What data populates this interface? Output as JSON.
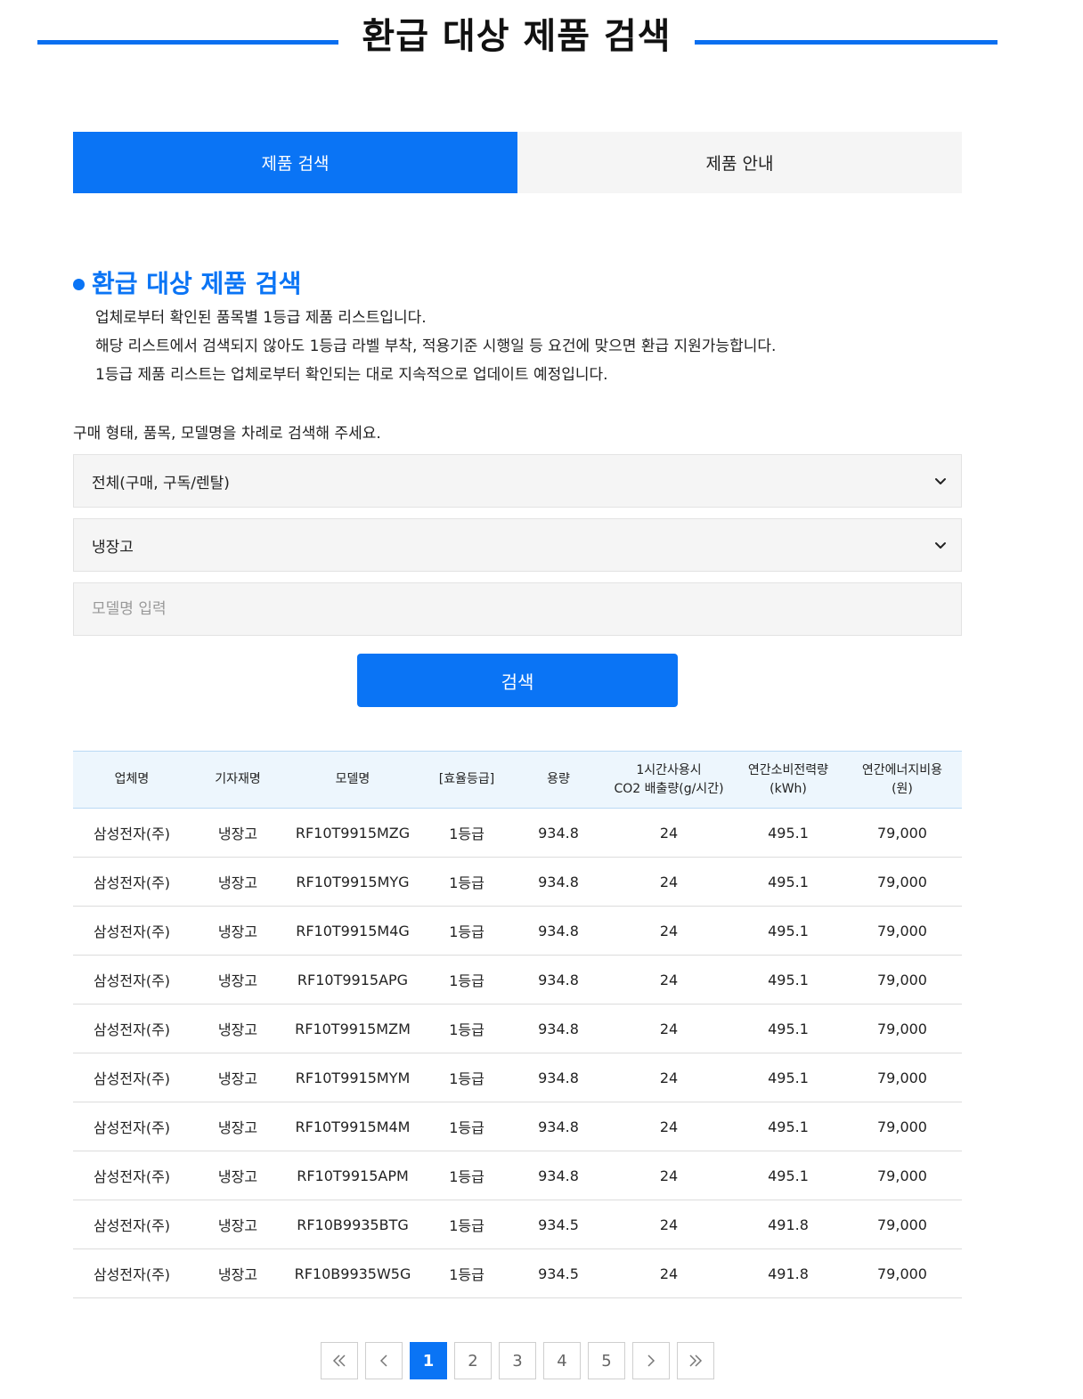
{
  "header": {
    "title": "환급 대상 제품 검색"
  },
  "tabs": [
    {
      "label": "제품 검색",
      "active": true
    },
    {
      "label": "제품 안내",
      "active": false
    }
  ],
  "section": {
    "title": "환급 대상 제품 검색",
    "desc": [
      "업체로부터 확인된 품목별 1등급 제품 리스트입니다.",
      "해당 리스트에서 검색되지 않아도 1등급 라벨 부착, 적용기준 시행일 등 요건에 맞으면 환급 지원가능합니다.",
      "1등급 제품 리스트는 업체로부터 확인되는 대로 지속적으로 업데이트 예정입니다."
    ]
  },
  "form": {
    "guide": "구매 형태, 품목, 모델명을 차례로 검색해 주세요.",
    "purchase_type": "전체(구매, 구독/렌탈)",
    "category": "냉장고",
    "model_placeholder": "모델명 입력",
    "model_value": "",
    "search_label": "검색"
  },
  "table": {
    "headers": {
      "maker": "업체명",
      "type": "기자재명",
      "model": "모델명",
      "grade": "[효율등급]",
      "capacity": "용량",
      "co2_line1": "1시간사용시",
      "co2_line2": "CO2 배출량(g/시간)",
      "kwh_line1": "연간소비전력량",
      "kwh_line2": "(kWh)",
      "cost_line1": "연간에너지비용",
      "cost_line2": "(원)"
    },
    "rows": [
      [
        "삼성전자(주)",
        "냉장고",
        "RF10T9915MZG",
        "1등급",
        "934.8",
        "24",
        "495.1",
        "79,000"
      ],
      [
        "삼성전자(주)",
        "냉장고",
        "RF10T9915MYG",
        "1등급",
        "934.8",
        "24",
        "495.1",
        "79,000"
      ],
      [
        "삼성전자(주)",
        "냉장고",
        "RF10T9915M4G",
        "1등급",
        "934.8",
        "24",
        "495.1",
        "79,000"
      ],
      [
        "삼성전자(주)",
        "냉장고",
        "RF10T9915APG",
        "1등급",
        "934.8",
        "24",
        "495.1",
        "79,000"
      ],
      [
        "삼성전자(주)",
        "냉장고",
        "RF10T9915MZM",
        "1등급",
        "934.8",
        "24",
        "495.1",
        "79,000"
      ],
      [
        "삼성전자(주)",
        "냉장고",
        "RF10T9915MYM",
        "1등급",
        "934.8",
        "24",
        "495.1",
        "79,000"
      ],
      [
        "삼성전자(주)",
        "냉장고",
        "RF10T9915M4M",
        "1등급",
        "934.8",
        "24",
        "495.1",
        "79,000"
      ],
      [
        "삼성전자(주)",
        "냉장고",
        "RF10T9915APM",
        "1등급",
        "934.8",
        "24",
        "495.1",
        "79,000"
      ],
      [
        "삼성전자(주)",
        "냉장고",
        "RF10B9935BTG",
        "1등급",
        "934.5",
        "24",
        "491.8",
        "79,000"
      ],
      [
        "삼성전자(주)",
        "냉장고",
        "RF10B9935W5G",
        "1등급",
        "934.5",
        "24",
        "491.8",
        "79,000"
      ]
    ]
  },
  "pagination": {
    "pages": [
      "1",
      "2",
      "3",
      "4",
      "5"
    ],
    "current": "1",
    "icons": {
      "first": "double-chevron-left-icon",
      "prev": "chevron-left-icon",
      "next": "chevron-right-icon",
      "last": "double-chevron-right-icon"
    }
  },
  "colors": {
    "accent": "#0a74f5",
    "header_line": "#0a6ff0",
    "table_head_bg": "#edf6fd",
    "field_bg": "#f5f5f5"
  }
}
